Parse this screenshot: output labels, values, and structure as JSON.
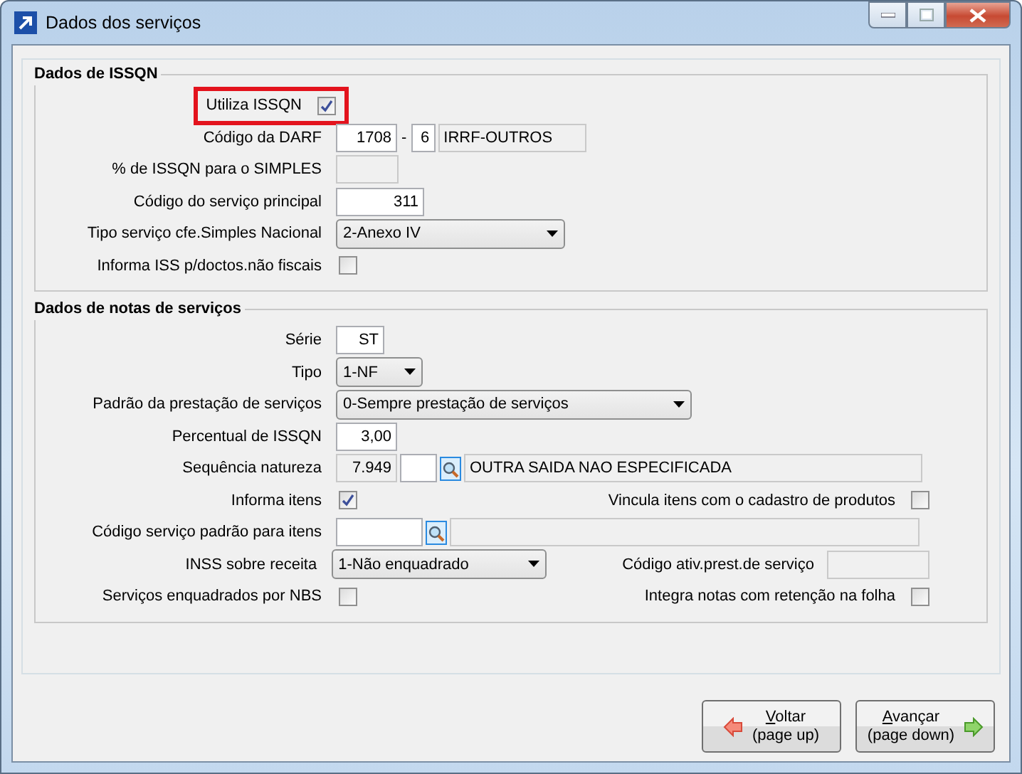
{
  "window": {
    "title": "Dados dos serviços"
  },
  "groups": [
    {
      "title": "Dados de ISSQN",
      "rows": [
        {
          "label": "Utiliza ISSQN",
          "highlighted": true,
          "controls": [
            {
              "kind": "checkbox",
              "checked": true
            }
          ]
        },
        {
          "label": "Código da DARF",
          "controls": [
            {
              "kind": "text",
              "value": "1708"
            },
            {
              "kind": "sep",
              "value": "-"
            },
            {
              "kind": "text",
              "value": "6"
            },
            {
              "kind": "description",
              "value": "IRRF-OUTROS"
            }
          ]
        },
        {
          "label": "% de ISSQN para o SIMPLES",
          "controls": [
            {
              "kind": "readonly"
            }
          ]
        },
        {
          "label": "Código do serviço principal",
          "controls": [
            {
              "kind": "text",
              "value": "311"
            }
          ]
        },
        {
          "label": "Tipo serviço cfe.Simples Nacional",
          "controls": [
            {
              "kind": "select",
              "value": "2-Anexo IV"
            }
          ]
        },
        {
          "label": "Informa ISS p/doctos.não fiscais",
          "controls": [
            {
              "kind": "checkbox",
              "checked": false
            }
          ]
        }
      ]
    },
    {
      "title": "Dados de notas de serviços",
      "rows": [
        {
          "label": "Série",
          "controls": [
            {
              "kind": "text",
              "value": "ST"
            }
          ]
        },
        {
          "label": "Tipo",
          "controls": [
            {
              "kind": "select",
              "value": "1-NF"
            }
          ]
        },
        {
          "label": "Padrão da prestação de serviços",
          "controls": [
            {
              "kind": "select",
              "value": "0-Sempre prestação de serviços"
            }
          ]
        },
        {
          "label": "Percentual de ISSQN",
          "controls": [
            {
              "kind": "text",
              "value": "3,00"
            }
          ]
        },
        {
          "label": "Sequência natureza",
          "controls": [
            {
              "kind": "readonly",
              "value": "7.949"
            },
            {
              "kind": "text"
            },
            {
              "kind": "lookup"
            },
            {
              "kind": "description",
              "value": "OUTRA SAIDA NAO ESPECIFICADA"
            }
          ]
        },
        {
          "label": "Informa itens",
          "controls": [
            {
              "kind": "checkbox",
              "checked": true
            }
          ],
          "right": {
            "label": "Vincula itens com o cadastro de produtos",
            "control": {
              "kind": "checkbox",
              "checked": false
            }
          }
        },
        {
          "label": "Código serviço padrão para itens",
          "controls": [
            {
              "kind": "text"
            },
            {
              "kind": "lookup"
            },
            {
              "kind": "description"
            }
          ]
        },
        {
          "label": "INSS sobre receita",
          "controls": [
            {
              "kind": "select",
              "value": "1-Não enquadrado"
            }
          ],
          "right": {
            "label": "Código ativ.prest.de serviço",
            "control": {
              "kind": "readonly"
            }
          }
        },
        {
          "label": "Serviços enquadrados por NBS",
          "controls": [
            {
              "kind": "checkbox",
              "checked": false
            }
          ],
          "right": {
            "label": "Integra notas com retenção na folha",
            "control": {
              "kind": "checkbox",
              "checked": false
            }
          }
        }
      ]
    }
  ],
  "buttons": [
    {
      "label": "Voltar",
      "sub": "(page up)",
      "kind": "back"
    },
    {
      "label": "Avançar",
      "sub": "(page down)",
      "kind": "next"
    }
  ]
}
